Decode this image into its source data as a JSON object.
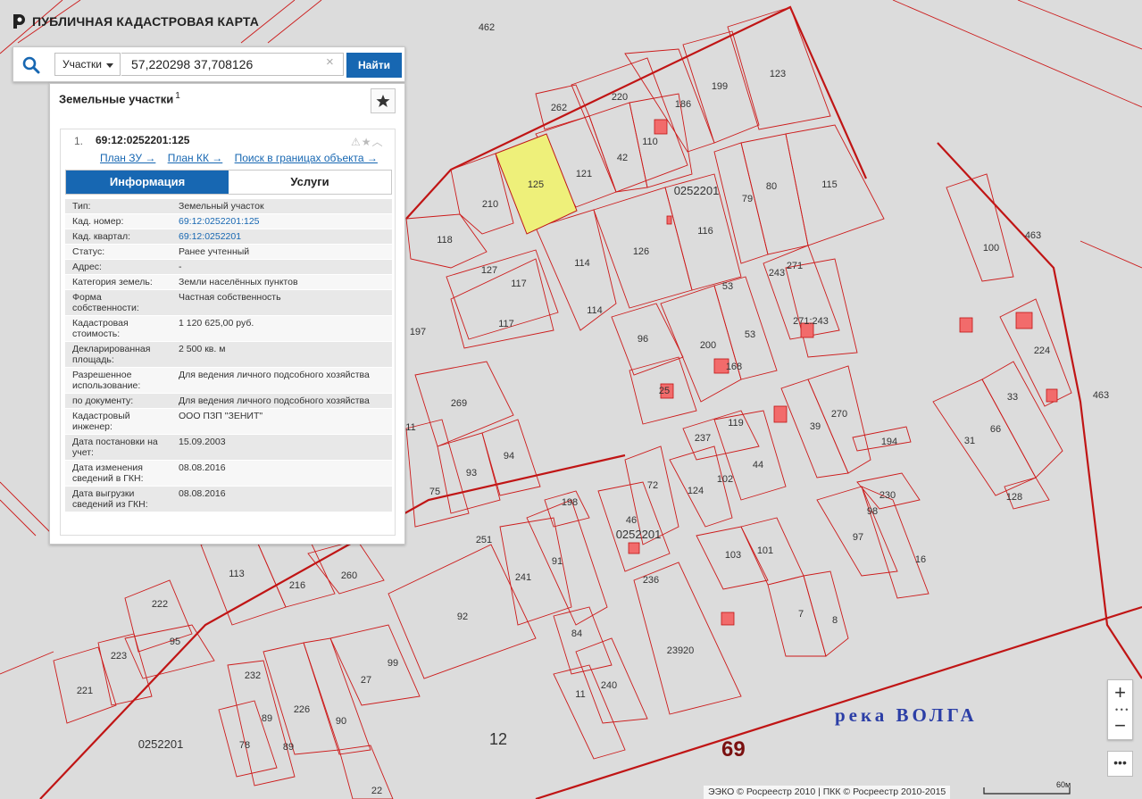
{
  "app": {
    "title": "ПУБЛИЧНАЯ КАДАСТРОВАЯ КАРТА"
  },
  "search": {
    "type_label": "Участки",
    "value": "57,220298 37,708126",
    "clear_label": "×",
    "button_label": "Найти"
  },
  "results": {
    "header": "Земельные участки",
    "count": "1",
    "card": {
      "index": "1.",
      "title": "69:12:0252201:125",
      "links": [
        "План ЗУ →",
        "План КК →",
        "Поиск в границах объекта →"
      ],
      "tabs": [
        "Информация",
        "Услуги"
      ],
      "rows": [
        {
          "k": "Тип:",
          "v": "Земельный участок"
        },
        {
          "k": "Кад. номер:",
          "v": "69:12:0252201:125"
        },
        {
          "k": "Кад. квартал:",
          "v": "69:12:0252201"
        },
        {
          "k": "Статус:",
          "v": "Ранее учтенный"
        },
        {
          "k": "Адрес:",
          "v": "-"
        },
        {
          "k": "Категория земель:",
          "v": "Земли населённых пунктов"
        },
        {
          "k": "Форма собственности:",
          "v": "Частная собственность"
        },
        {
          "k": "Кадастровая стоимость:",
          "v": "1 120 625,00 руб."
        },
        {
          "k": "Декларированная площадь:",
          "v": "2 500 кв. м"
        },
        {
          "k": "Разрешенное использование:",
          "v": "Для ведения личного подсобного хозяйства"
        },
        {
          "k": "по документу:",
          "v": "Для ведения личного подсобного хозяйства"
        },
        {
          "k": "Кадастровый инженер:",
          "v": "ООО ПЗП \"ЗЕНИТ\""
        },
        {
          "k": "Дата постановки на учет:",
          "v": "15.09.2003"
        },
        {
          "k": "Дата изменения сведений в ГКН:",
          "v": "08.08.2016"
        },
        {
          "k": "Дата выгрузки сведений из ГКН:",
          "v": "08.08.2016"
        }
      ]
    }
  },
  "map": {
    "river_label": "река ВОЛГА",
    "district_label": "69",
    "zone_label": "12",
    "quarter_labels": [
      "0252201",
      "0252201",
      "0252201"
    ],
    "parcels": [
      "462",
      "262",
      "220",
      "186",
      "199",
      "123",
      "110",
      "121",
      "42",
      "125",
      "210",
      "118",
      "0252201",
      "79",
      "80",
      "115",
      "116",
      "463",
      "100",
      "127",
      "117",
      "114",
      "126",
      "53",
      "243",
      "271",
      "197",
      "117",
      "114",
      "96",
      "200",
      "53",
      "271:243",
      "168",
      "25",
      "269",
      "119",
      "237",
      "39",
      "270",
      "194",
      "102",
      "44",
      "124",
      "11",
      "93",
      "94",
      "75",
      "72",
      "198",
      "46",
      "251",
      "241",
      "91",
      "230",
      "98",
      "97",
      "16",
      "224",
      "33",
      "463",
      "31",
      "66",
      "128",
      "113",
      "216",
      "260",
      "92",
      "222",
      "95",
      "103",
      "101",
      "7",
      "8",
      "236",
      "84",
      "240",
      "11",
      "23920",
      "223",
      "221",
      "232",
      "226",
      "89",
      "90",
      "78",
      "89",
      "27",
      "99",
      "22"
    ],
    "scale_label": "60м",
    "attribution": "ЭЭКО © Росреестр 2010 | ПКК © Росреестр 2010-2015",
    "colors": {
      "boundary": "#cc1a1a",
      "selected_fill": "#eef07a",
      "building": "#f26b6b",
      "background": "#dcdcdc",
      "accent": "#1767b2"
    }
  },
  "controls": {
    "zoom_in": "+",
    "zoom_out": "−",
    "more": "•••"
  }
}
